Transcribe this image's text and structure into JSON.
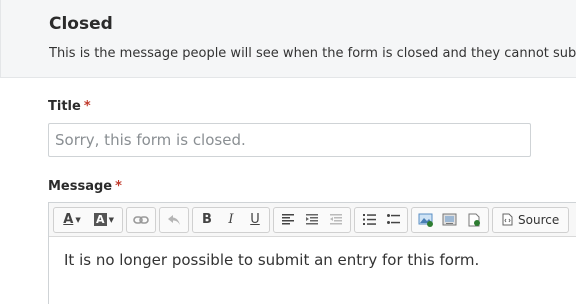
{
  "panel": {
    "title": "Closed",
    "description": "This is the message people will see when the form is closed and they cannot submit an entry."
  },
  "fields": {
    "title": {
      "label": "Title",
      "required_mark": "*",
      "placeholder": "Sorry, this form is closed.",
      "value": ""
    },
    "message": {
      "label": "Message",
      "required_mark": "*",
      "content": "It is no longer possible to submit an entry for this form."
    }
  },
  "toolbar": {
    "text_color_letter": "A",
    "bg_color_letter": "A",
    "bold": "B",
    "italic": "I",
    "underline": "U",
    "source_label": "Source",
    "accent_color": "#2e7d32"
  }
}
